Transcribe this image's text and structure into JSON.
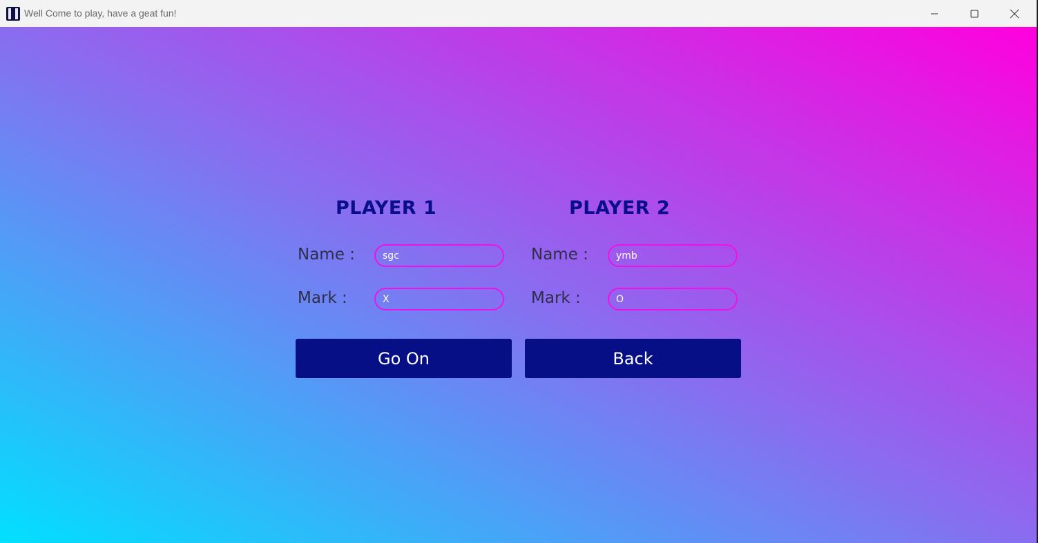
{
  "window": {
    "title": "Well Come to play, have a geat fun!",
    "controls": {
      "minimize": "minimize-icon",
      "maximize": "maximize-icon",
      "close": "close-icon"
    }
  },
  "player1": {
    "heading": "PLAYER 1",
    "name_label": "Name :",
    "name_value": "sgc",
    "mark_label": "Mark :",
    "mark_value": "X"
  },
  "player2": {
    "heading": "PLAYER 2",
    "name_label": "Name :",
    "name_value": "ymb",
    "mark_label": "Mark :",
    "mark_value": "O"
  },
  "buttons": {
    "go_on": "Go On",
    "back": "Back"
  },
  "colors": {
    "gradient_start": "#00e0ff",
    "gradient_mid": "#8a6cf0",
    "gradient_end": "#ff00de",
    "heading": "#0b0e8c",
    "button_bg": "#070f86",
    "field_border": "#ea14e6"
  }
}
